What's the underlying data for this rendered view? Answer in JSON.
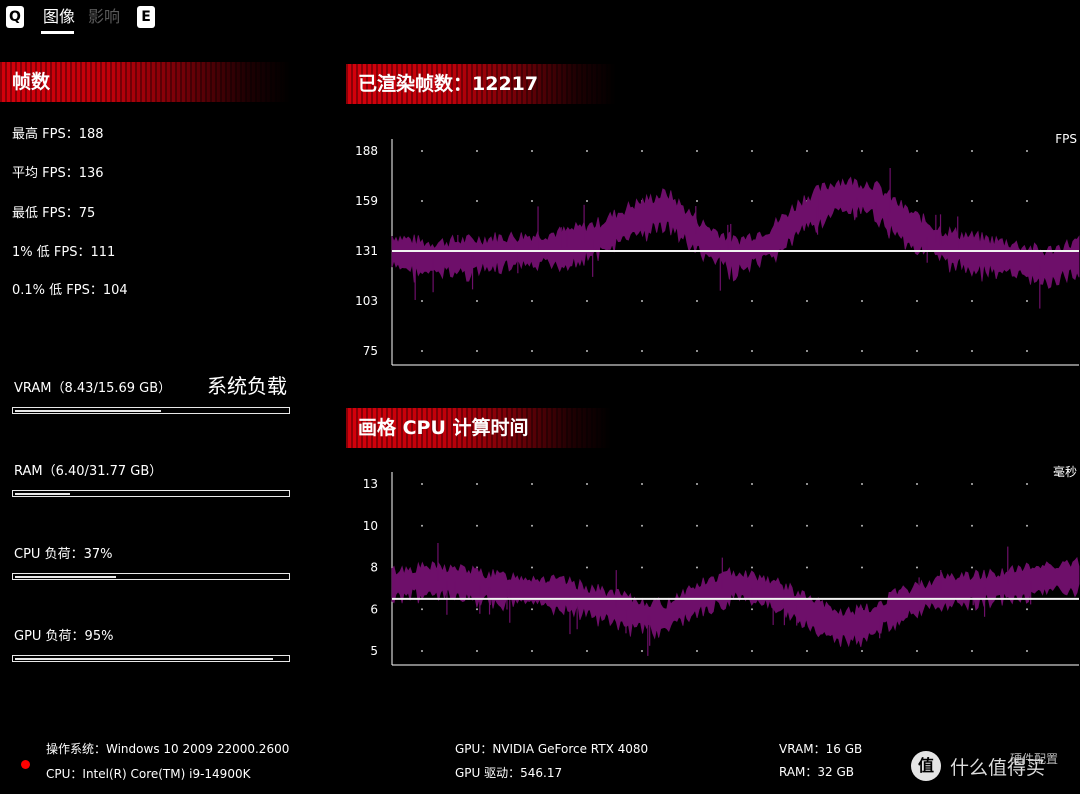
{
  "tabs": {
    "left_key": "Q",
    "right_key": "E",
    "items": [
      {
        "label": "图像",
        "active": true
      },
      {
        "label": "影响",
        "active": false
      }
    ]
  },
  "frames_panel": {
    "title": "帧数",
    "max_fps": "最高 FPS：188",
    "avg_fps": "平均 FPS：136",
    "min_fps": "最低 FPS：75",
    "low_1pct": "1% 低 FPS：111",
    "low_01pct": "0.1% 低 FPS：104"
  },
  "system_load": {
    "title": "系统负载",
    "bars": [
      {
        "label": "VRAM（8.43/15.69 GB）",
        "fraction": 0.537
      },
      {
        "label": "RAM（6.40/31.77 GB）",
        "fraction": 0.201
      },
      {
        "label": "CPU 负荷：37%",
        "fraction": 0.37
      },
      {
        "label": "GPU 负荷：95%",
        "fraction": 0.95
      }
    ]
  },
  "fps_chart_header": "已渲染帧数：12217",
  "cpu_chart_header": "画格 CPU 计算时间",
  "chart_data": [
    {
      "type": "area",
      "unit_label": "FPS",
      "y_ticks": [
        "188",
        "159",
        "131",
        "103",
        "75"
      ],
      "ylim": [
        75,
        188
      ],
      "average": 131,
      "series_color": "#6e0f6a",
      "x": [
        0,
        5,
        10,
        15,
        20,
        25,
        30,
        35,
        40,
        45,
        50,
        55,
        60,
        65,
        70,
        75,
        80,
        85,
        90,
        95,
        100
      ],
      "y": [
        131,
        127,
        128,
        130,
        131,
        133,
        138,
        148,
        155,
        138,
        128,
        135,
        152,
        162,
        160,
        145,
        134,
        130,
        127,
        122,
        128
      ]
    },
    {
      "type": "area",
      "unit_label": "毫秒",
      "y_ticks": [
        "13",
        "10",
        "8",
        "6",
        "5"
      ],
      "ylim": [
        5,
        13
      ],
      "average": 6.5,
      "series_color": "#6e0f6a",
      "x": [
        0,
        5,
        10,
        15,
        20,
        25,
        30,
        35,
        40,
        45,
        50,
        55,
        60,
        65,
        70,
        75,
        80,
        85,
        90,
        95,
        100
      ],
      "y": [
        7.2,
        7.4,
        7.3,
        7.0,
        6.9,
        6.7,
        6.3,
        5.9,
        5.8,
        6.6,
        7.2,
        6.8,
        6.0,
        5.6,
        5.7,
        6.3,
        6.9,
        7.0,
        7.2,
        7.5,
        7.6
      ]
    }
  ],
  "footer": {
    "os": "操作系统：Windows 10 2009 22000.2600",
    "cpu": "CPU：Intel(R) Core(TM) i9-14900K",
    "gpu": "GPU：NVIDIA GeForce RTX 4080",
    "driver": "GPU 驱动：546.17",
    "vram": "VRAM：16 GB",
    "ram": "RAM：32 GB",
    "hw_config": "硬件配置"
  },
  "watermark": {
    "glyph": "值",
    "text": "什么值得买"
  }
}
